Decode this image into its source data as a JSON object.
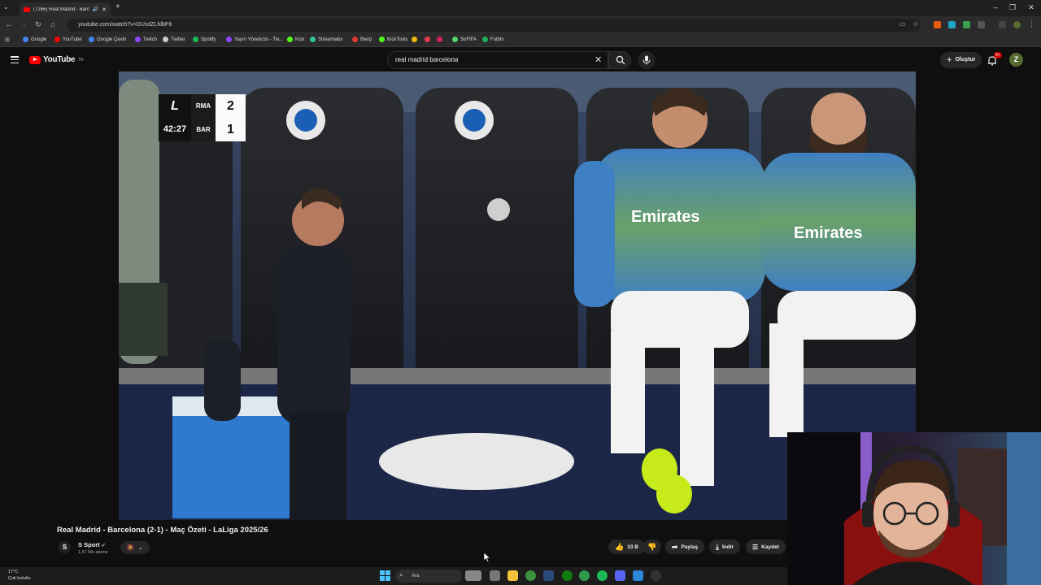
{
  "browser": {
    "tab_count_label": "(7266) Real Madrid - Barcel",
    "url": "youtube.com/watch?v=DUsdZLhlbP8",
    "window_controls": [
      "–",
      "❐",
      "✕"
    ],
    "bookmarks": [
      {
        "label": "Google",
        "color": "#4285f4"
      },
      {
        "label": "YouTube",
        "color": "#ff0000"
      },
      {
        "label": "Google Çeviri",
        "color": "#4285f4"
      },
      {
        "label": "Twitch",
        "color": "#9146ff"
      },
      {
        "label": "Twitter",
        "color": "#cccccc"
      },
      {
        "label": "Spotify",
        "color": "#1db954"
      },
      {
        "label": "Yayın Yöneticisi - Tw...",
        "color": "#9146ff"
      },
      {
        "label": "Kick",
        "color": "#53fc18"
      },
      {
        "label": "Streamlabs",
        "color": "#31c3a2"
      },
      {
        "label": "Bierp",
        "color": "#e53935"
      },
      {
        "label": "KickTools",
        "color": "#53fc18"
      },
      {
        "label": "",
        "color": "#f0b90b"
      },
      {
        "label": "",
        "color": "#e53950"
      },
      {
        "label": "",
        "color": "#d61f69"
      },
      {
        "label": "SoFIFA",
        "color": "#53d769"
      },
      {
        "label": "Futbin",
        "color": "#1fae5b"
      }
    ]
  },
  "youtube": {
    "logo_text": "YouTube",
    "region": "TR",
    "search_query": "real madrid barcelona",
    "create_label": "Oluştur",
    "notif_count": "9+",
    "avatar_letter": "Z"
  },
  "scorebug": {
    "league_logo": "L",
    "team1": "RMA",
    "score1": "2",
    "team2": "BAR",
    "score2": "1",
    "clock": "42:27"
  },
  "video_info": {
    "title": "Real Madrid - Barcelona (2-1) - Maç Özeti - LaLiga 2025/26",
    "channel_name": "S Sport",
    "channel_avatar": "S",
    "subscribers": "1,57 Mn abone",
    "likes": "33 B",
    "share_label": "Paylaş",
    "download_label": "İndir",
    "save_label": "Kaydet"
  },
  "taskbar": {
    "temperature": "17°C",
    "weather_desc": "Çok bulutlu",
    "search_label": "Ara"
  }
}
